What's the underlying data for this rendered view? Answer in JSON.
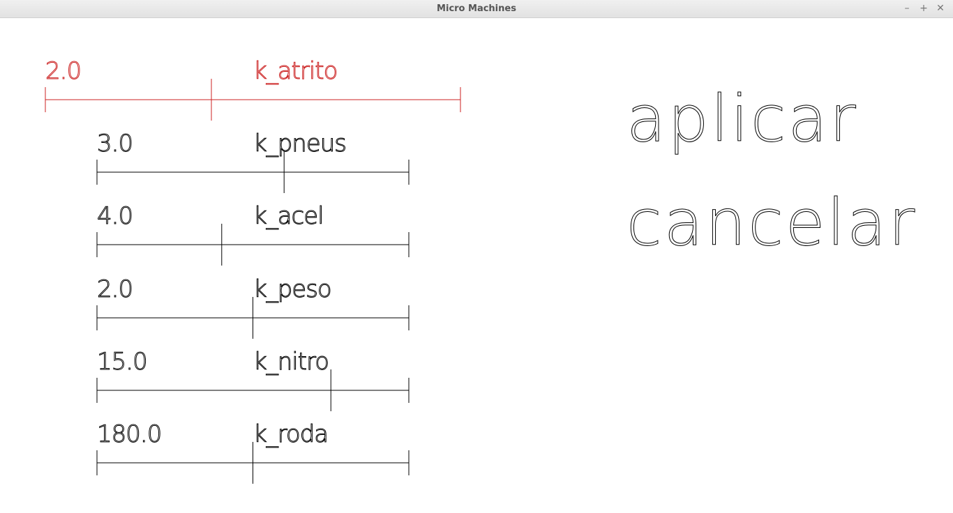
{
  "window": {
    "title": "Micro Machines",
    "controls": {
      "minimize": "–",
      "maximize": "+",
      "close": "✕"
    }
  },
  "colors": {
    "active": "#cc2222",
    "normal": "#000000",
    "titlebar_text": "#555555"
  },
  "sliders": [
    {
      "value_text": "2.0",
      "label": "k_atrito",
      "value": 2.0,
      "fraction": 0.4,
      "active": true
    },
    {
      "value_text": "3.0",
      "label": "k_pneus",
      "value": 3.0,
      "fraction": 0.6,
      "active": false
    },
    {
      "value_text": "4.0",
      "label": "k_acel",
      "value": 4.0,
      "fraction": 0.4,
      "active": false
    },
    {
      "value_text": "2.0",
      "label": "k_peso",
      "value": 2.0,
      "fraction": 0.5,
      "active": false
    },
    {
      "value_text": "15.0",
      "label": "k_nitro",
      "value": 15.0,
      "fraction": 0.75,
      "active": false
    },
    {
      "value_text": "180.0",
      "label": "k_roda",
      "value": 180.0,
      "fraction": 0.5,
      "active": false
    }
  ],
  "actions": {
    "apply": "aplicar",
    "cancel": "cancelar"
  }
}
